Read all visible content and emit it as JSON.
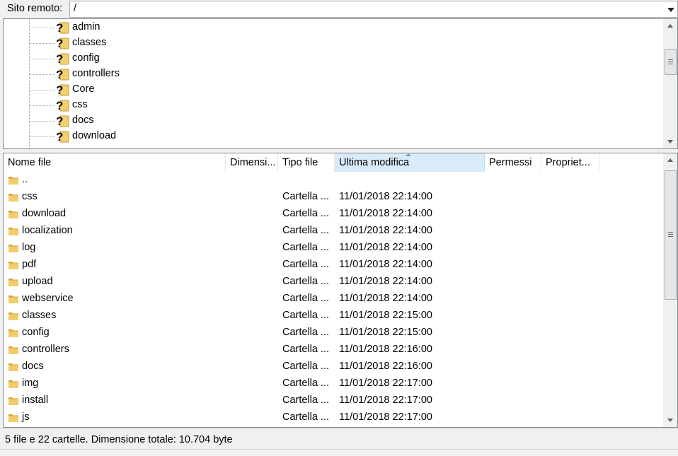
{
  "site_bar": {
    "label": "Sito remoto:",
    "path": "/"
  },
  "tree": {
    "items": [
      {
        "label": "admin"
      },
      {
        "label": "classes"
      },
      {
        "label": "config"
      },
      {
        "label": "controllers"
      },
      {
        "label": "Core"
      },
      {
        "label": "css"
      },
      {
        "label": "docs"
      },
      {
        "label": "download"
      }
    ]
  },
  "columns": {
    "name": "Nome file",
    "size": "Dimensi...",
    "type": "Tipo file",
    "modified": "Ultima modifica",
    "perms": "Permessi",
    "owner": "Propriet..."
  },
  "rows": [
    {
      "name": "..",
      "type": "",
      "date": ""
    },
    {
      "name": "css",
      "type": "Cartella ...",
      "date": "11/01/2018 22:14:00"
    },
    {
      "name": "download",
      "type": "Cartella ...",
      "date": "11/01/2018 22:14:00"
    },
    {
      "name": "localization",
      "type": "Cartella ...",
      "date": "11/01/2018 22:14:00"
    },
    {
      "name": "log",
      "type": "Cartella ...",
      "date": "11/01/2018 22:14:00"
    },
    {
      "name": "pdf",
      "type": "Cartella ...",
      "date": "11/01/2018 22:14:00"
    },
    {
      "name": "upload",
      "type": "Cartella ...",
      "date": "11/01/2018 22:14:00"
    },
    {
      "name": "webservice",
      "type": "Cartella ...",
      "date": "11/01/2018 22:14:00"
    },
    {
      "name": "classes",
      "type": "Cartella ...",
      "date": "11/01/2018 22:15:00"
    },
    {
      "name": "config",
      "type": "Cartella ...",
      "date": "11/01/2018 22:15:00"
    },
    {
      "name": "controllers",
      "type": "Cartella ...",
      "date": "11/01/2018 22:16:00"
    },
    {
      "name": "docs",
      "type": "Cartella ...",
      "date": "11/01/2018 22:16:00"
    },
    {
      "name": "img",
      "type": "Cartella ...",
      "date": "11/01/2018 22:17:00"
    },
    {
      "name": "install",
      "type": "Cartella ...",
      "date": "11/01/2018 22:17:00"
    },
    {
      "name": "js",
      "type": "Cartella ...",
      "date": "11/01/2018 22:17:00"
    }
  ],
  "status": "5 file e 22 cartelle. Dimensione totale: 10.704 byte",
  "colors": {
    "sorted_header": "#d9ebf9",
    "folder": "#e8b84a"
  },
  "icons": {
    "tree_item": "unknown-folder-icon",
    "row": "folder-icon"
  }
}
